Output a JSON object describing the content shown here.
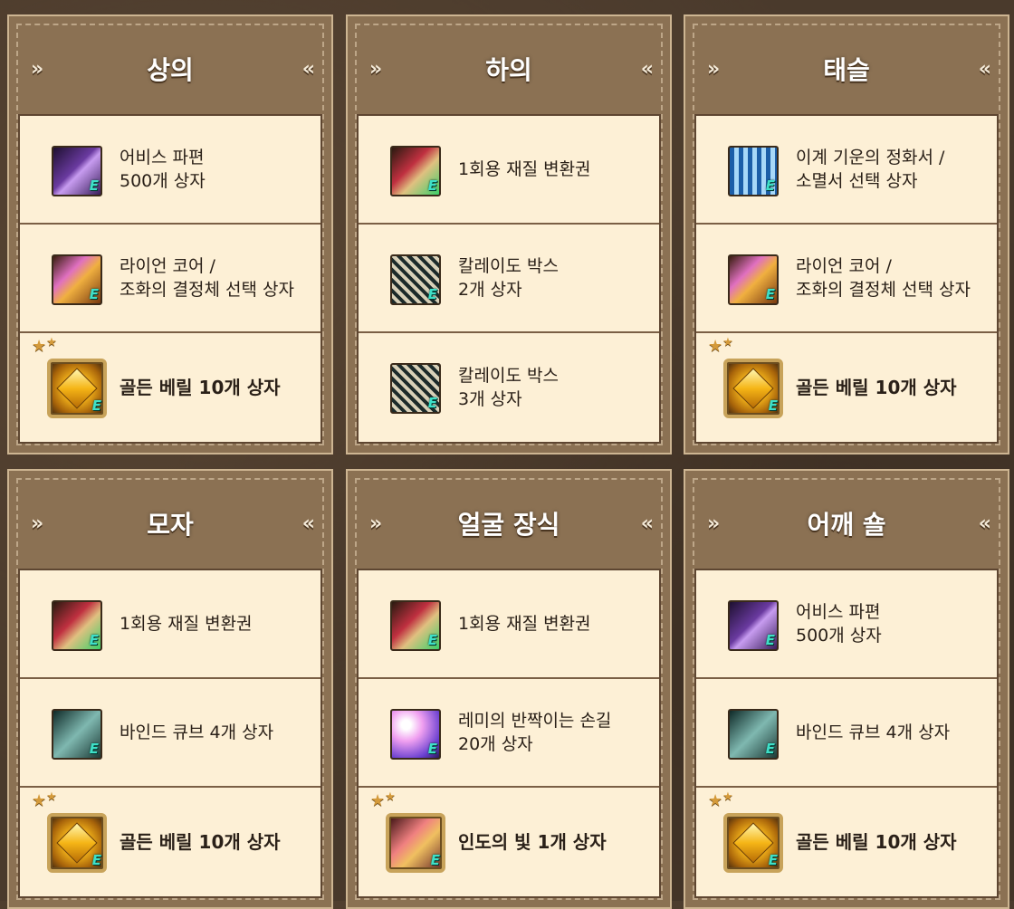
{
  "panels": [
    {
      "title": "상의",
      "items": [
        {
          "label": "어비스 파편\n500개 상자",
          "icon": "abyss-fragment-icon",
          "highlight": false
        },
        {
          "label": "라이언 코어 /\n조화의 결정체 선택 상자",
          "icon": "lion-core-chest-icon",
          "highlight": false
        },
        {
          "label": "골든 베릴 10개 상자",
          "icon": "golden-beryl-icon",
          "highlight": true
        }
      ]
    },
    {
      "title": "하의",
      "items": [
        {
          "label": "1회용 재질 변환권",
          "icon": "material-ticket-icon",
          "highlight": false
        },
        {
          "label": "칼레이도 박스\n2개 상자",
          "icon": "kaleido-box-icon",
          "highlight": false
        },
        {
          "label": "칼레이도 박스\n3개 상자",
          "icon": "kaleido-box-icon",
          "highlight": false
        }
      ]
    },
    {
      "title": "태슬",
      "items": [
        {
          "label": "이계 기운의 정화서 /\n소멸서 선택 상자",
          "icon": "purify-scroll-box-icon",
          "highlight": false
        },
        {
          "label": "라이언 코어 /\n조화의 결정체 선택 상자",
          "icon": "lion-core-chest-icon",
          "highlight": false
        },
        {
          "label": "골든 베릴 10개 상자",
          "icon": "golden-beryl-icon",
          "highlight": true
        }
      ]
    },
    {
      "title": "모자",
      "items": [
        {
          "label": "1회용 재질 변환권",
          "icon": "material-ticket-icon",
          "highlight": false
        },
        {
          "label": "바인드 큐브 4개 상자",
          "icon": "bind-cube-icon",
          "highlight": false
        },
        {
          "label": "골든 베릴 10개 상자",
          "icon": "golden-beryl-icon",
          "highlight": true
        }
      ]
    },
    {
      "title": "얼굴 장식",
      "items": [
        {
          "label": "1회용 재질 변환권",
          "icon": "material-ticket-icon",
          "highlight": false
        },
        {
          "label": "레미의 반짝이는 손길\n20개 상자",
          "icon": "lemi-touch-icon",
          "highlight": false
        },
        {
          "label": "인도의 빛 1개 상자",
          "icon": "indo-light-icon",
          "highlight": true
        }
      ]
    },
    {
      "title": "어깨 숄",
      "items": [
        {
          "label": "어비스 파편\n500개 상자",
          "icon": "abyss-fragment-icon",
          "highlight": false
        },
        {
          "label": "바인드 큐브 4개 상자",
          "icon": "bind-cube-icon",
          "highlight": false
        },
        {
          "label": "골든 베릴 10개 상자",
          "icon": "golden-beryl-icon",
          "highlight": true
        }
      ]
    }
  ],
  "badge_letter": "E",
  "chevron_left": "»",
  "chevron_right": "«",
  "star_glyph": "★"
}
